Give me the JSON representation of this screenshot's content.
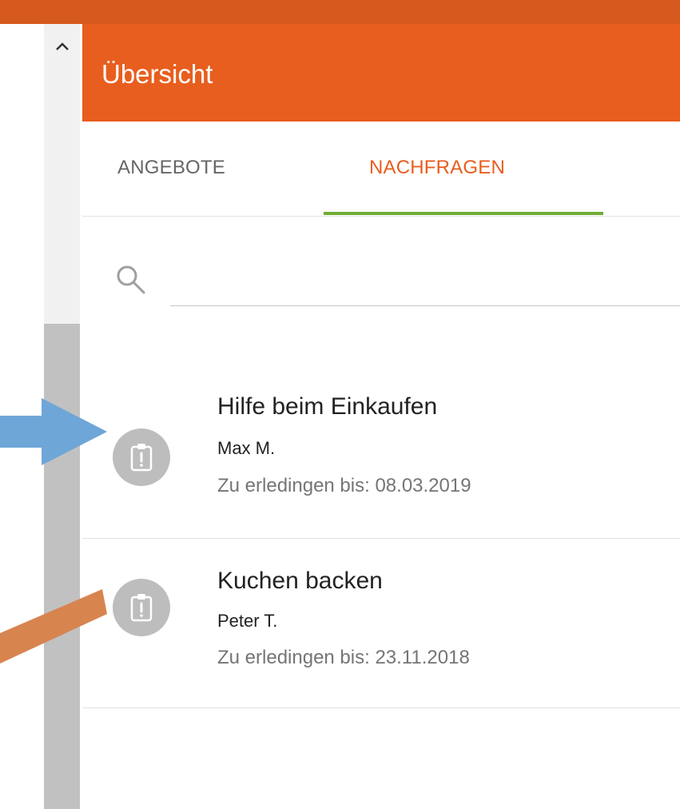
{
  "header": {
    "title": "Übersicht"
  },
  "tabs": [
    {
      "label": "ANGEBOTE",
      "active": false
    },
    {
      "label": "NACHFRAGEN",
      "active": true
    }
  ],
  "search": {
    "icon": "search-icon",
    "value": ""
  },
  "requests": [
    {
      "title": "Hilfe beim Einkaufen",
      "person": "Max M.",
      "due": "Zu erledingen bis: 08.03.2019",
      "icon": "clipboard-alert-icon"
    },
    {
      "title": "Kuchen backen",
      "person": "Peter T.",
      "due": "Zu erledingen bis: 23.11.2018",
      "icon": "clipboard-alert-icon"
    }
  ],
  "colors": {
    "header": "#e85e1e",
    "top_strip": "#d65a1d",
    "active_tab_text": "#e85e1e",
    "tab_indicator": "#6fac35",
    "avatar": "#bdbdbd",
    "annotation_arrow_blue": "#6fa6d8",
    "annotation_arrow_orange": "#d8844f"
  }
}
